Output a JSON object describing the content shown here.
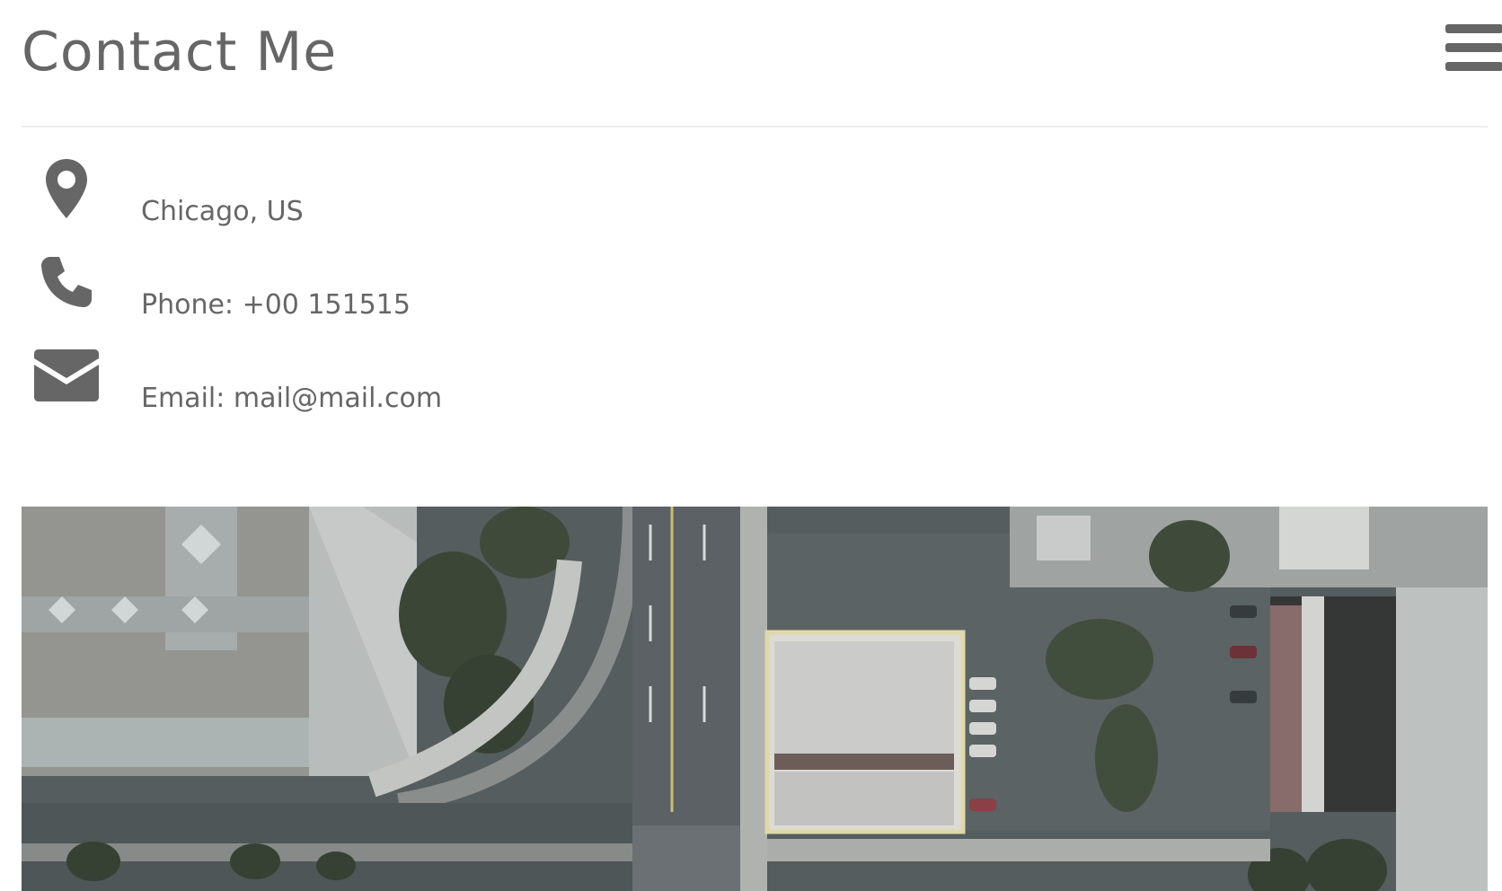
{
  "header": {
    "title": "Contact Me",
    "menu_icon": "hamburger-menu-icon"
  },
  "contact": {
    "items": [
      {
        "icon": "map-pin-icon",
        "text": "Chicago, US"
      },
      {
        "icon": "phone-icon",
        "text": "Phone: +00 151515"
      },
      {
        "icon": "envelope-icon",
        "text": "Email: mail@mail.com"
      }
    ]
  },
  "photo": {
    "subject": "aerial city street view",
    "grayscale": true
  },
  "colors": {
    "text": "#666666",
    "divider": "#eeeeee",
    "background": "#ffffff"
  }
}
